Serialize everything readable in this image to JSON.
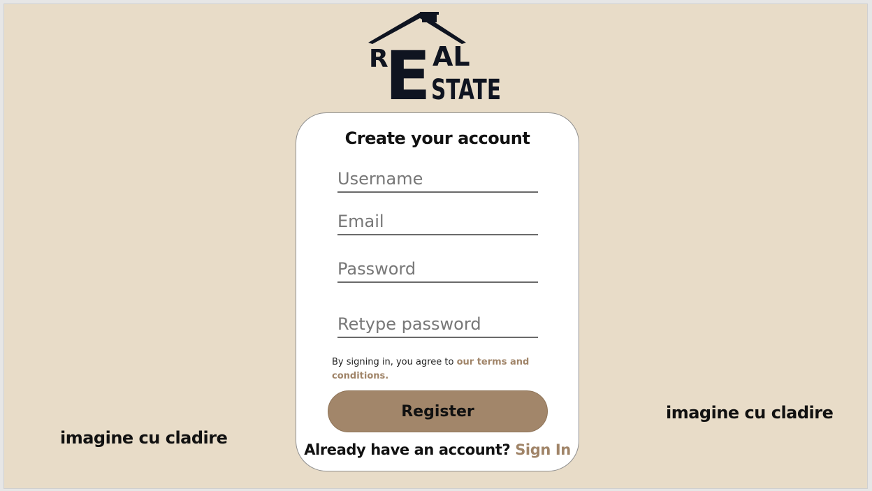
{
  "logo": {
    "letters": {
      "r": "R",
      "e": "E",
      "al": "AL",
      "state": "STATE"
    },
    "color": "#0f1420"
  },
  "form": {
    "title": "Create your account",
    "username_placeholder": "Username",
    "email_placeholder": "Email",
    "password_placeholder": "Password",
    "retype_placeholder": "Retype password",
    "terms_prefix": "By signing in, you agree to ",
    "terms_link": "our terms and conditions.",
    "register_label": "Register",
    "signin_prompt": "Already have an account?",
    "signin_link": "Sign In"
  },
  "placeholders": {
    "left_image_text": "imagine cu cladire",
    "right_image_text": "imagine cu cladire"
  },
  "colors": {
    "background": "#e8dcc8",
    "accent": "#a2866a",
    "link": "#a08468",
    "card": "#ffffff"
  }
}
